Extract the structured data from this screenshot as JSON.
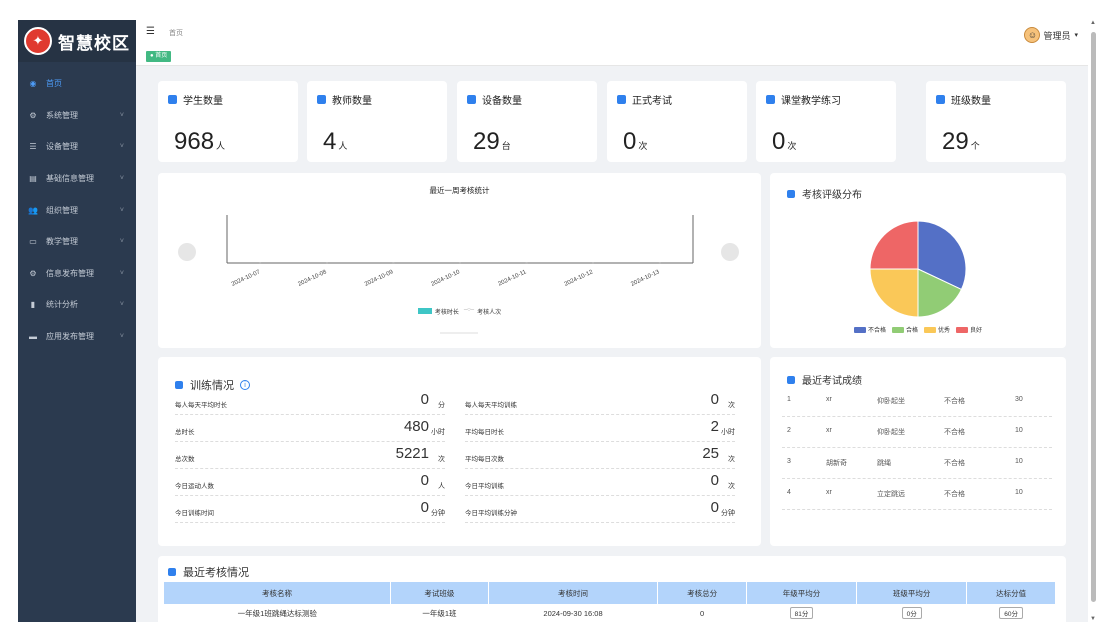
{
  "brand": {
    "name": "智慧校区"
  },
  "sidebar": {
    "items": [
      {
        "label": "首页",
        "icon": "dashboard-icon",
        "active": true,
        "chev": ""
      },
      {
        "label": "系统管理",
        "icon": "gear-icon",
        "active": false,
        "chev": "˅"
      },
      {
        "label": "设备管理",
        "icon": "list-icon",
        "active": false,
        "chev": "˅"
      },
      {
        "label": "基础信息管理",
        "icon": "doc-icon",
        "active": false,
        "chev": "˅"
      },
      {
        "label": "组织管理",
        "icon": "people-icon",
        "active": false,
        "chev": "˅"
      },
      {
        "label": "教学管理",
        "icon": "calendar-icon",
        "active": false,
        "chev": "˅"
      },
      {
        "label": "信息发布管理",
        "icon": "settings-icon",
        "active": false,
        "chev": "˅"
      },
      {
        "label": "统计分析",
        "icon": "bar-chart-icon",
        "active": false,
        "chev": "˅"
      },
      {
        "label": "应用发布管理",
        "icon": "monitor-icon",
        "active": false,
        "chev": "˅"
      }
    ]
  },
  "header": {
    "breadcrumb": "首页",
    "tag": "● 首页",
    "user": "管理员"
  },
  "stats": [
    {
      "title": "学生数量",
      "value": "968",
      "unit": "人"
    },
    {
      "title": "教师数量",
      "value": "4",
      "unit": "人"
    },
    {
      "title": "设备数量",
      "value": "29",
      "unit": "台"
    },
    {
      "title": "正式考试",
      "value": "0",
      "unit": "次"
    },
    {
      "title": "课堂教学练习",
      "value": "0",
      "unit": "次"
    },
    {
      "title": "班级数量",
      "value": "29",
      "unit": "个"
    }
  ],
  "weekly": {
    "title": "最近一周考核统计",
    "legend_bar": "考核时长",
    "legend_line": "考核人次"
  },
  "chart_data": [
    {
      "type": "bar",
      "title": "最近一周考核统计",
      "categories": [
        "2024-10-07",
        "2024-10-08",
        "2024-10-09",
        "2024-10-10",
        "2024-10-11",
        "2024-10-12",
        "2024-10-13"
      ],
      "series": [
        {
          "name": "考核时长",
          "values": [
            0,
            0,
            0,
            0,
            0,
            0,
            0
          ]
        },
        {
          "name": "考核人次",
          "values": [
            0,
            0,
            0,
            0,
            0,
            0,
            0
          ]
        }
      ]
    },
    {
      "type": "pie",
      "title": "考核评级分布",
      "categories": [
        "不合格",
        "合格",
        "优秀",
        "良好"
      ],
      "values": [
        32,
        18,
        25,
        25
      ],
      "colors": [
        "#5470c6",
        "#91cc75",
        "#fac858",
        "#ee6666"
      ],
      "legend": "bottom"
    }
  ],
  "pie": {
    "title": "考核评级分布"
  },
  "training": {
    "title": "训练情况",
    "left": [
      {
        "label": "每人每天平均时长",
        "value": "0",
        "unit": "分"
      },
      {
        "label": "总时长",
        "value": "480",
        "unit": "小时"
      },
      {
        "label": "总次数",
        "value": "5221",
        "unit": "次"
      },
      {
        "label": "今日运动人数",
        "value": "0",
        "unit": "人"
      },
      {
        "label": "今日训练时间",
        "value": "0",
        "unit": "分钟"
      }
    ],
    "right": [
      {
        "label": "每人每天平均训练",
        "value": "0",
        "unit": "次"
      },
      {
        "label": "平均每日时长",
        "value": "2",
        "unit": "小时"
      },
      {
        "label": "平均每日次数",
        "value": "25",
        "unit": "次"
      },
      {
        "label": "今日平均训练",
        "value": "0",
        "unit": "次"
      },
      {
        "label": "今日平均训练分钟",
        "value": "0",
        "unit": "分钟"
      }
    ]
  },
  "recent_exam": {
    "title": "最近考试成绩",
    "rows": [
      [
        "1",
        "xr",
        "仰卧起坐",
        "不合格",
        "30"
      ],
      [
        "2",
        "xr",
        "仰卧起坐",
        "不合格",
        "10"
      ],
      [
        "3",
        "胡新奇",
        "跳绳",
        "不合格",
        "10"
      ],
      [
        "4",
        "xr",
        "立定跳远",
        "不合格",
        "10"
      ]
    ]
  },
  "assess": {
    "title": "最近考核情况",
    "headers": [
      "考核名称",
      "考试班级",
      "考核时间",
      "考核总分",
      "年级平均分",
      "班级平均分",
      "达标分值"
    ],
    "rows": [
      [
        "一年级1班跳绳达标测验",
        "一年级1班",
        "2024-09-30 16:08",
        "0",
        "81分",
        "0分",
        "60分"
      ]
    ]
  }
}
